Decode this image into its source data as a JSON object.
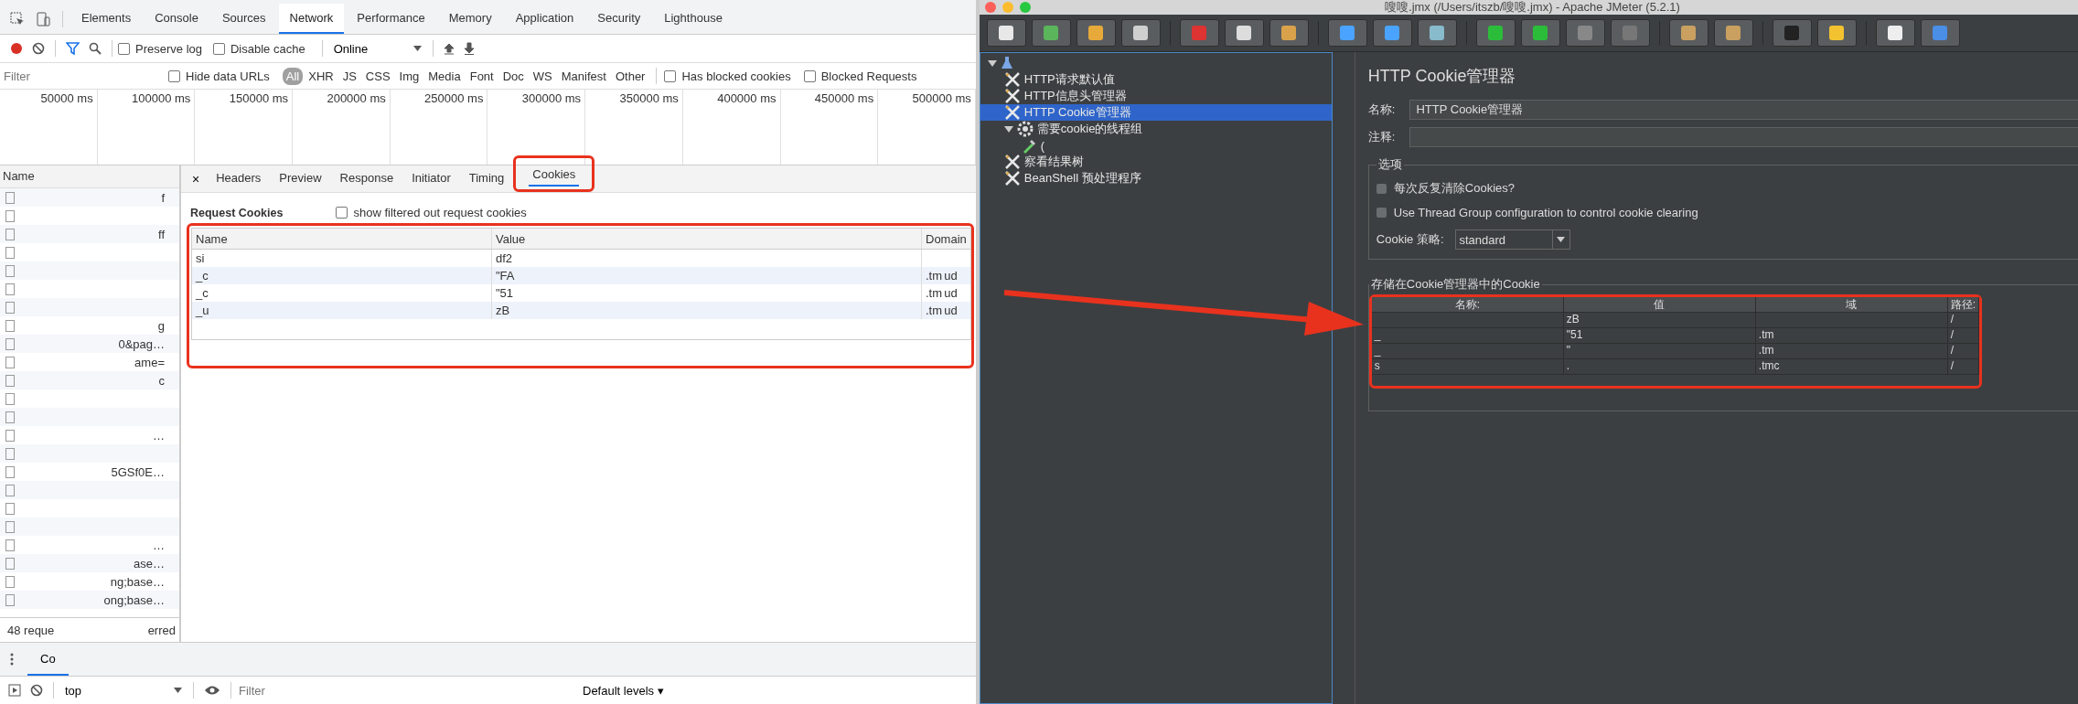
{
  "devtools": {
    "tabs": [
      {
        "label": "Elements",
        "selected": false
      },
      {
        "label": "Console",
        "selected": false
      },
      {
        "label": "Sources",
        "selected": false
      },
      {
        "label": "Network",
        "selected": true
      },
      {
        "label": "Performance",
        "selected": false
      },
      {
        "label": "Memory",
        "selected": false
      },
      {
        "label": "Application",
        "selected": false
      },
      {
        "label": "Security",
        "selected": false
      },
      {
        "label": "Lighthouse",
        "selected": false
      }
    ],
    "toolbar": {
      "preserve_log": {
        "label": "Preserve log",
        "checked": false
      },
      "disable_cache": {
        "label": "Disable cache",
        "checked": false
      },
      "throttling": "Online"
    },
    "filter": {
      "placeholder": "Filter",
      "hide_data_urls": {
        "label": "Hide data URLs",
        "checked": false
      },
      "types": [
        {
          "label": "All",
          "selected": true
        },
        {
          "label": "XHR",
          "selected": false
        },
        {
          "label": "JS",
          "selected": false
        },
        {
          "label": "CSS",
          "selected": false
        },
        {
          "label": "Img",
          "selected": false
        },
        {
          "label": "Media",
          "selected": false
        },
        {
          "label": "Font",
          "selected": false
        },
        {
          "label": "Doc",
          "selected": false
        },
        {
          "label": "WS",
          "selected": false
        },
        {
          "label": "Manifest",
          "selected": false
        },
        {
          "label": "Other",
          "selected": false
        }
      ],
      "has_blocked_cookies": {
        "label": "Has blocked cookies",
        "checked": false
      },
      "blocked_requests": {
        "label": "Blocked Requests",
        "checked": false
      }
    },
    "timeline_ticks": [
      "50000 ms",
      "100000 ms",
      "150000 ms",
      "200000 ms",
      "250000 ms",
      "300000 ms",
      "350000 ms",
      "400000 ms",
      "450000 ms",
      "500000 ms"
    ],
    "requests": {
      "header": "Name",
      "items": [
        {
          "kind": "request",
          "name": "f"
        },
        {
          "kind": "request"
        },
        {
          "kind": "request",
          "name": "ff"
        },
        {
          "kind": "request"
        },
        {
          "kind": "request"
        },
        {
          "kind": "request"
        },
        {
          "kind": "request"
        },
        {
          "kind": "request",
          "name": "g"
        },
        {
          "kind": "request",
          "name": "0&pag…"
        },
        {
          "kind": "request",
          "name": "ame="
        },
        {
          "kind": "request",
          "name": "c"
        },
        {
          "kind": "request"
        },
        {
          "kind": "request"
        },
        {
          "kind": "request",
          "name": "…"
        },
        {
          "kind": "request"
        },
        {
          "kind": "request",
          "name": "5GSf0E…"
        },
        {
          "kind": "request"
        },
        {
          "kind": "request"
        },
        {
          "kind": "request"
        },
        {
          "kind": "request",
          "name": "…"
        },
        {
          "kind": "request",
          "name": "ase…"
        },
        {
          "kind": "request",
          "name": "ng;base…"
        },
        {
          "kind": "request",
          "name": "ong;base…"
        }
      ],
      "status_start": "48 reque",
      "status_end": "erred"
    },
    "detail_close": "×",
    "detail_tabs": [
      {
        "label": "Headers",
        "selected": false
      },
      {
        "label": "Preview",
        "selected": false
      },
      {
        "label": "Response",
        "selected": false
      },
      {
        "label": "Initiator",
        "selected": false
      },
      {
        "label": "Timing",
        "selected": false
      },
      {
        "label": "Cookies",
        "selected": true
      }
    ],
    "request_cookies": {
      "title": "Request Cookies",
      "show_filtered": {
        "label": "show filtered out request cookies",
        "checked": false
      },
      "columns": [
        "Name",
        "Value",
        "Domain"
      ],
      "rows": [
        {
          "name": "si",
          "value": "df2",
          "domain": "",
          "domain_tail": ""
        },
        {
          "name": "_c",
          "value": "\"FA",
          "domain": ".tm",
          "domain_tail": "ud"
        },
        {
          "name": "_c",
          "value": "\"51",
          "domain": ".tm",
          "domain_tail": "ud"
        },
        {
          "name": "_u",
          "value": "zB",
          "domain": ".tm",
          "domain_tail": "ud"
        }
      ]
    },
    "console": {
      "tab": "Co",
      "context": "top",
      "filter_placeholder": "Filter",
      "levels": "Default levels ▾"
    }
  },
  "jmeter": {
    "title": "嗖嗖.jmx (/Users/itszb/嗖嗖.jmx) - Apache JMeter (5.2.1)",
    "tree": [
      {
        "expanded": true,
        "selected": false,
        "children": [
          {
            "label": "HTTP请求默认值",
            "selected": false
          },
          {
            "label": "HTTP信息头管理器",
            "selected": false
          },
          {
            "label": "HTTP Cookie管理器",
            "selected": true
          },
          {
            "label": "需要cookie的线程组",
            "selected": false,
            "expanded": true,
            "children": [
              {
                "label": "(",
                "selected": false
              }
            ]
          },
          {
            "label": "察看结果树",
            "selected": false
          },
          {
            "label": "BeanShell 预处理程序",
            "selected": false
          }
        ]
      }
    ],
    "panel": {
      "title": "HTTP Cookie管理器",
      "name_label": "名称:",
      "name_value": "HTTP Cookie管理器",
      "comment_label": "注释:",
      "options_title": "选项",
      "options": [
        {
          "label": "每次反复清除Cookies?",
          "checked": false
        },
        {
          "label": "Use Thread Group configuration to control cookie clearing",
          "checked": false
        }
      ],
      "policy_label": "Cookie 策略:",
      "policy_value": "standard",
      "stored_title": "存储在Cookie管理器中的Cookie",
      "columns": [
        "名称:",
        "值",
        "域",
        "路径:"
      ],
      "rows": [
        {
          "name": "",
          "value": "zB",
          "domain": "",
          "path": "/"
        },
        {
          "name": "_",
          "value": "\"51",
          "domain": ".tm",
          "path": "/"
        },
        {
          "name": "_",
          "value": "\"",
          "domain": ".tm",
          "path": "/"
        },
        {
          "name": "s",
          "value": ".",
          "domain": ".tmc",
          "path": "/"
        }
      ]
    }
  }
}
